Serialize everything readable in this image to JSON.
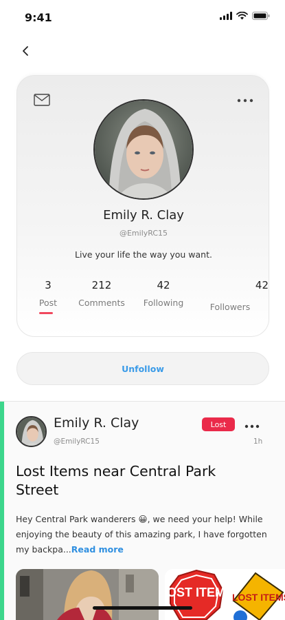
{
  "status_bar": {
    "time": "9:41",
    "icons": [
      "signal-icon",
      "wifi-icon",
      "battery-icon"
    ]
  },
  "navigation": {
    "back_icon": "chevron-left-icon"
  },
  "profile": {
    "name": "Emily R. Clay",
    "handle": "@EmilyRC15",
    "bio": "Live your life the way you want.",
    "stats": {
      "post": {
        "value": "3",
        "label": "Post"
      },
      "comments": {
        "value": "212",
        "label": "Comments"
      },
      "following": {
        "value": "42",
        "label": "Following"
      },
      "followers": {
        "value": "42",
        "label": "Followers"
      }
    },
    "active_tab": "Post",
    "actions": {
      "mail_icon": "mail-icon",
      "more_icon": "more-horizontal-icon"
    }
  },
  "unfollow_label": "Unfollow",
  "post": {
    "author_name": "Emily R. Clay",
    "author_handle": "@EmilyRC15",
    "badge": "Lost",
    "time": "1h",
    "title": "Lost Items near Central Park Street",
    "body_text": "Hey Central Park wanderers 😀, we need your help! While enjoying the beauty of this amazing park, I have forgotten my backpa...",
    "read_more": "Read more",
    "images": [
      {
        "description_icon": "photo-icon"
      },
      {
        "sign_text_1": "LOST ITEMS",
        "sign_text_2": "LOST ITEMS"
      }
    ]
  },
  "colors": {
    "accent_blue": "#3a9be8",
    "badge_red": "#ea2a4a",
    "underline_red": "#f0485d",
    "feed_accent_green": "#3dd68c"
  }
}
